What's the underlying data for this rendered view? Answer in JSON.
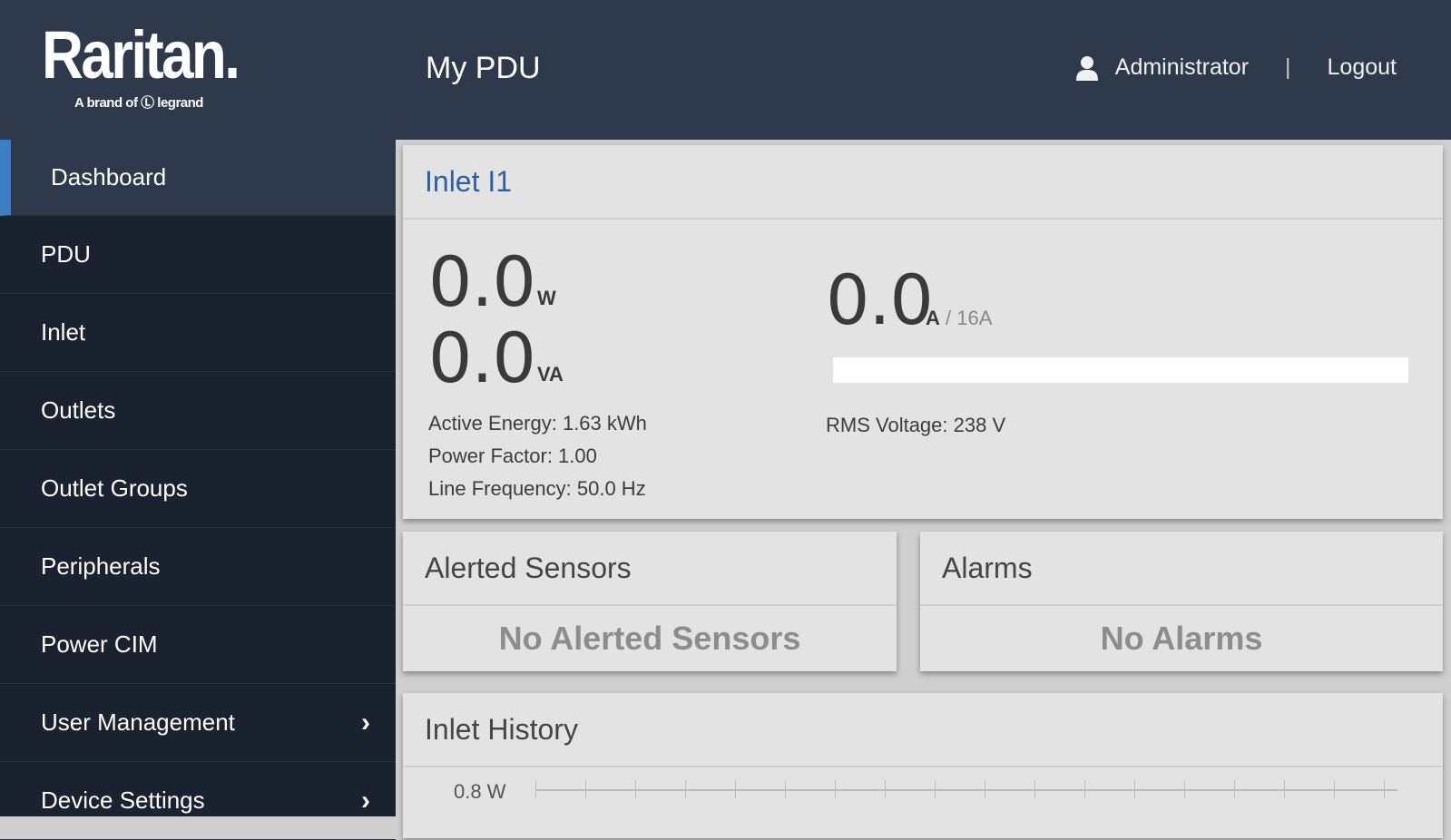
{
  "header": {
    "logo_text": "Raritan.",
    "logo_sub": "A brand of Ⓛ legrand",
    "page_title": "My PDU",
    "user_name": "Administrator",
    "separator": "|",
    "logout_label": "Logout",
    "colors": {
      "background": "#2e3a4b",
      "text": "#ffffff"
    }
  },
  "sidebar": {
    "items": [
      {
        "label": "Dashboard",
        "active": true
      },
      {
        "label": "PDU"
      },
      {
        "label": "Inlet"
      },
      {
        "label": "Outlets"
      },
      {
        "label": "Outlet Groups"
      },
      {
        "label": "Peripherals"
      },
      {
        "label": "Power CIM"
      },
      {
        "label": "User Management",
        "chevron": "›"
      },
      {
        "label": "Device Settings",
        "chevron": "›"
      }
    ],
    "colors": {
      "background": "#1a2230",
      "active": "#2e3a4b",
      "accent": "#3c7dc4"
    }
  },
  "inlet": {
    "title": "Inlet I1",
    "power_value": "0.0",
    "power_unit": "W",
    "apparent_value": "0.0",
    "apparent_unit": "VA",
    "current_value": "0.0",
    "current_unit": "A",
    "current_max": " / 16A",
    "current_fraction": 0.0,
    "active_energy": "Active Energy: 1.63 kWh",
    "power_factor": "Power Factor: 1.00",
    "line_frequency": "Line Frequency: 50.0 Hz",
    "rms_voltage": "RMS Voltage: 238 V"
  },
  "alerted_sensors": {
    "title": "Alerted Sensors",
    "empty_message": "No Alerted Sensors"
  },
  "alarms": {
    "title": "Alarms",
    "empty_message": "No Alarms"
  },
  "inlet_history": {
    "title": "Inlet History",
    "y_axis_top_label": "0.8 W"
  }
}
